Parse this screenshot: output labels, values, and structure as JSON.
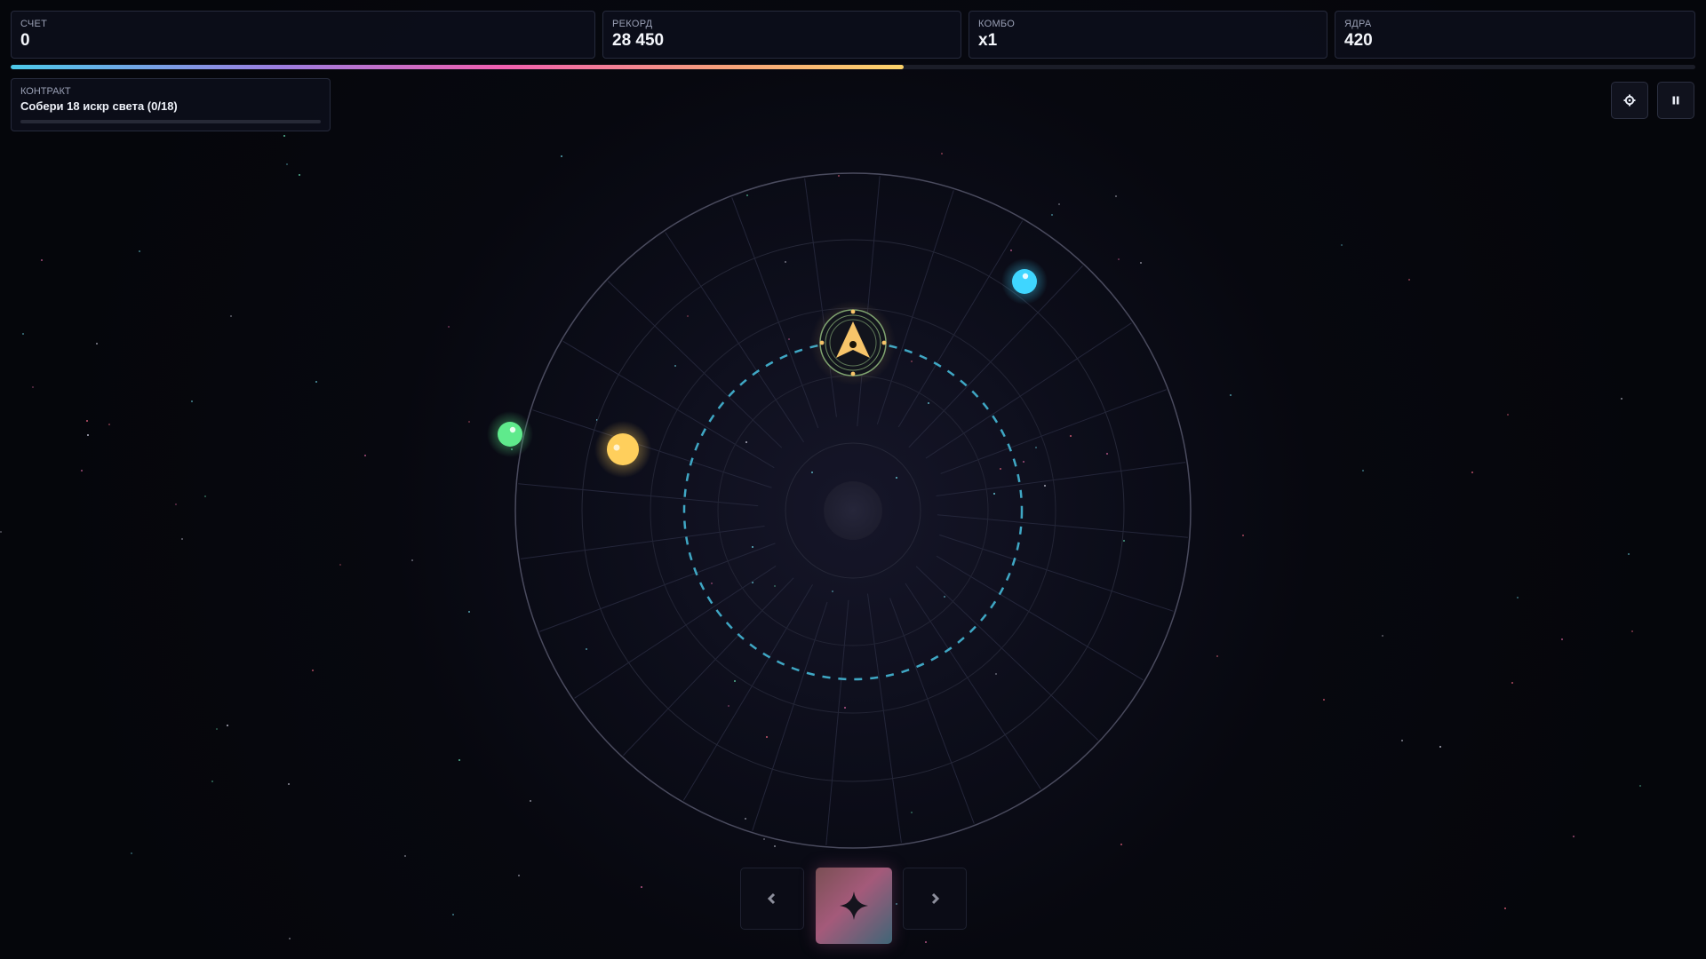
{
  "hud": {
    "score": {
      "label": "СЧЕТ",
      "value": "0"
    },
    "record": {
      "label": "РЕКОРД",
      "value": "28 450"
    },
    "combo": {
      "label": "КОМБО",
      "value": "x1"
    },
    "cores": {
      "label": "ЯДРА",
      "value": "420"
    }
  },
  "level_progress": 0.53,
  "contract": {
    "label": "КОНТРАКТ",
    "text": "Собери 18 искр света (0/18)",
    "progress": 0.0
  },
  "controls": {
    "settings_icon": "gear-icon",
    "pause_icon": "pause-icon",
    "prev_icon": "chevron-left-icon",
    "next_icon": "chevron-right-icon",
    "ability_icon": "four-point-star-icon"
  },
  "orbs": [
    {
      "name": "cyan-orb",
      "color": "#3fd6ff"
    },
    {
      "name": "green-orb",
      "color": "#5fea8c"
    },
    {
      "name": "yellow-orb",
      "color": "#ffcf5c"
    }
  ],
  "colors": {
    "accent_cyan": "#4cc9e8",
    "accent_pink": "#f05fb0",
    "accent_gold": "#fcd36a",
    "orbit_dashed": "#3fa7c4",
    "ship": "#f7c56a"
  }
}
